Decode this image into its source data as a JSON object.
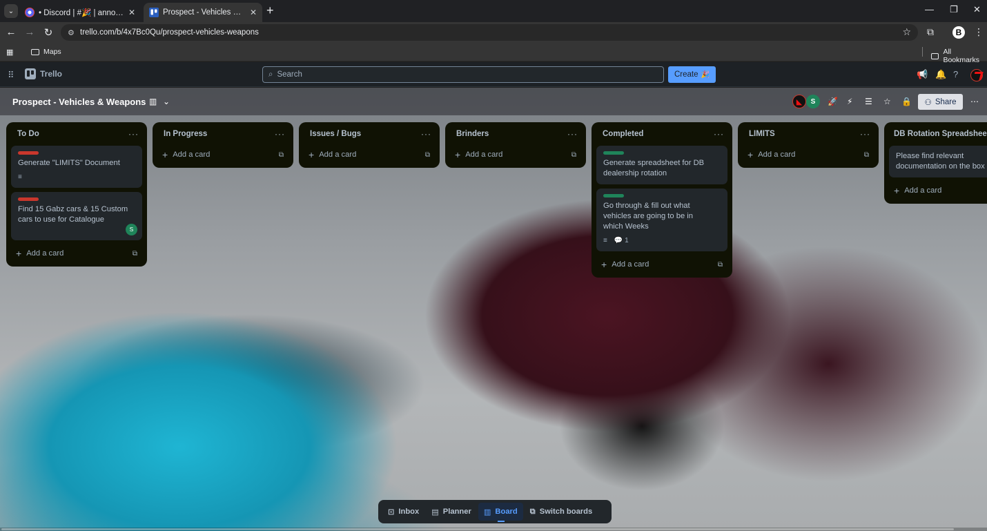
{
  "browser": {
    "tabs": [
      {
        "title": "• Discord | #🎉 | announcements",
        "close": "✕"
      },
      {
        "title": "Prospect - Vehicles & Weapons",
        "close": "✕"
      }
    ],
    "new_tab": "+",
    "url": "trello.com/b/4x7Bc0Qu/prospect-vehicles-weapons",
    "bookmarks": {
      "maps": "Maps",
      "all": "All Bookmarks"
    },
    "profile_initial": "B"
  },
  "header": {
    "brand": "Trello",
    "search_placeholder": "Search",
    "create_label": "Create"
  },
  "board": {
    "title": "Prospect - Vehicles & Weapons",
    "share_label": "Share",
    "member_initial": "S"
  },
  "lists": [
    {
      "title": "To Do",
      "cards": [
        {
          "title": "Generate \"LIMITS\" Document",
          "label_color": "#c9372c"
        },
        {
          "title": "Find 15 Gabz cars & 15 Custom cars to use for Catalogue",
          "label_color": "#c9372c",
          "member": "S"
        }
      ],
      "add": "Add a card"
    },
    {
      "title": "In Progress",
      "cards": [],
      "add": "Add a card"
    },
    {
      "title": "Issues / Bugs",
      "cards": [],
      "add": "Add a card"
    },
    {
      "title": "Brinders",
      "cards": [],
      "add": "Add a card"
    },
    {
      "title": "Completed",
      "cards": [
        {
          "title": "Generate spreadsheet for DB dealership rotation",
          "label_color": "#1f845a"
        },
        {
          "title": "Go through & fill out what vehicles are going to be in which Weeks",
          "label_color": "#1f845a",
          "comments": "1"
        }
      ],
      "add": "Add a card"
    },
    {
      "title": "LIMITS",
      "cards": [],
      "add": "Add a card"
    },
    {
      "title": "DB Rotation Spreadsheets",
      "cards": [
        {
          "title": "Please find relevant documentation on the box"
        }
      ],
      "add": "Add a card"
    }
  ],
  "switcher": {
    "inbox": "Inbox",
    "planner": "Planner",
    "board": "Board",
    "switch_boards": "Switch boards"
  },
  "colors": {
    "accent": "#579dff",
    "label_red": "#c9372c",
    "label_green": "#1f845a",
    "list_bg": "#101204",
    "card_bg": "#22272b"
  }
}
